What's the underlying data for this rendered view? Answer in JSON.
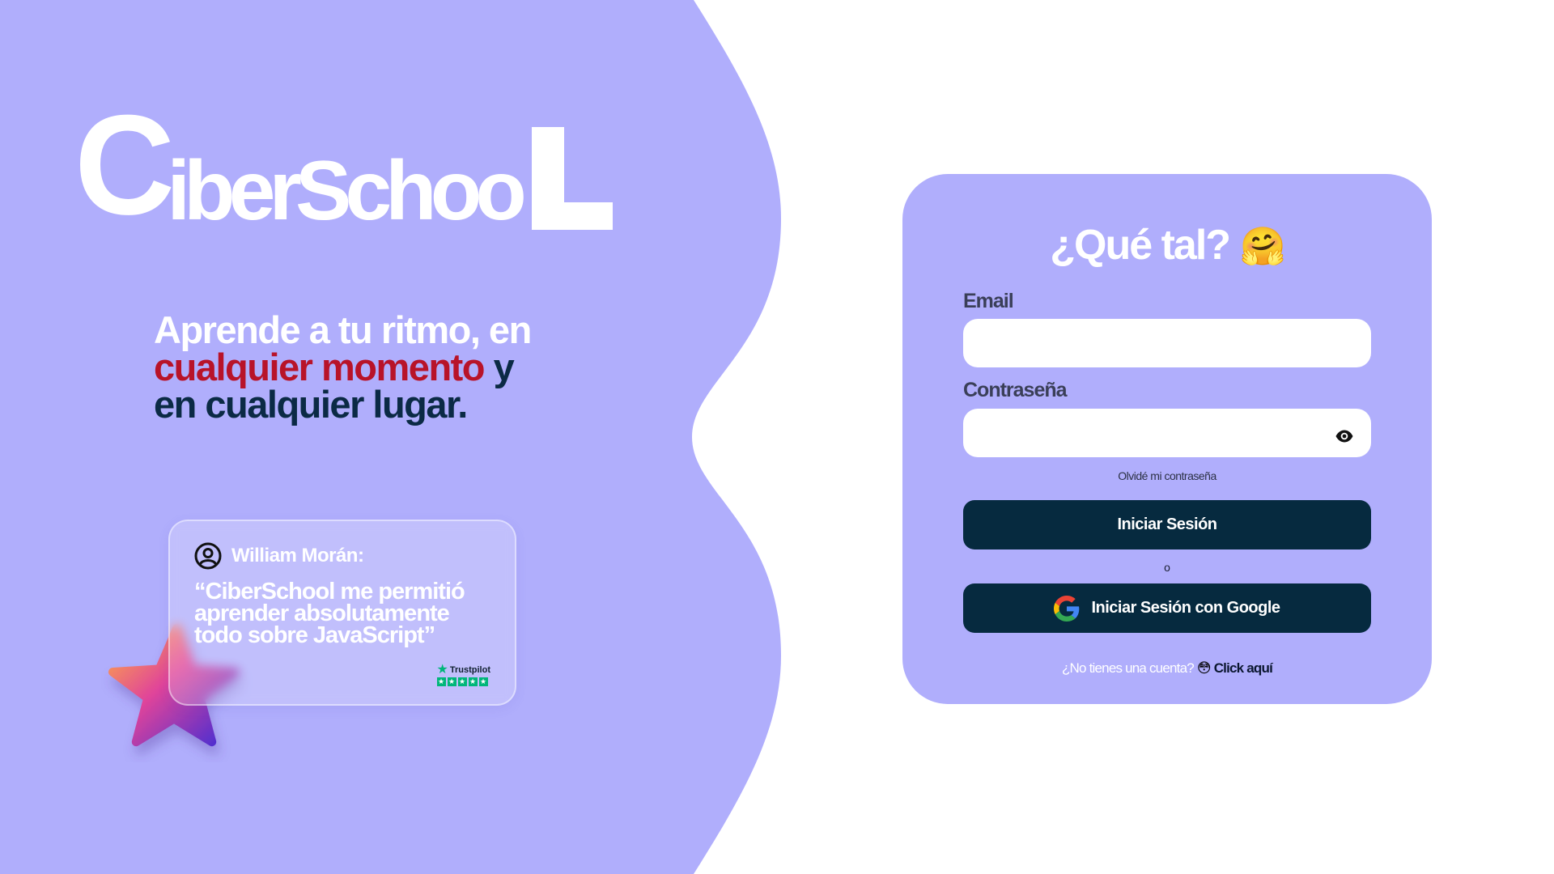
{
  "colors": {
    "lavender": "#b0aefc",
    "navy": "#062a3f",
    "red": "#b81329",
    "white": "#ffffff",
    "trustpilot_green": "#00b67a"
  },
  "logo": {
    "first": "C",
    "middle": "iberSchoo",
    "last": "L"
  },
  "hero": {
    "line1": "Aprende a tu ritmo, en",
    "highlight": "cualquier momento",
    "after_highlight": " y",
    "line3": "en cualquier lugar."
  },
  "testimonial": {
    "icon": "user-circle-icon",
    "author": "William Morán:",
    "quote": "“CiberSchool me permitió aprender absolutamente todo sobre JavaScript”",
    "badge_name": "Trustpilot",
    "badge_rating": 5
  },
  "login": {
    "title": "¿Qué tal?",
    "title_emoji": "🤗",
    "email_label": "Email",
    "email_value": "",
    "password_label": "Contraseña",
    "password_value": "",
    "password_toggle_icon": "eye-icon",
    "forgot": "Olvidé mi contraseña",
    "login_button": "Iniciar Sesión",
    "or": "o",
    "google_icon": "google-icon",
    "google_button": "Iniciar Sesión con Google",
    "signup_question": "¿No tienes una cuenta?",
    "signup_emoji": "😳",
    "signup_link": "Click aquí"
  }
}
